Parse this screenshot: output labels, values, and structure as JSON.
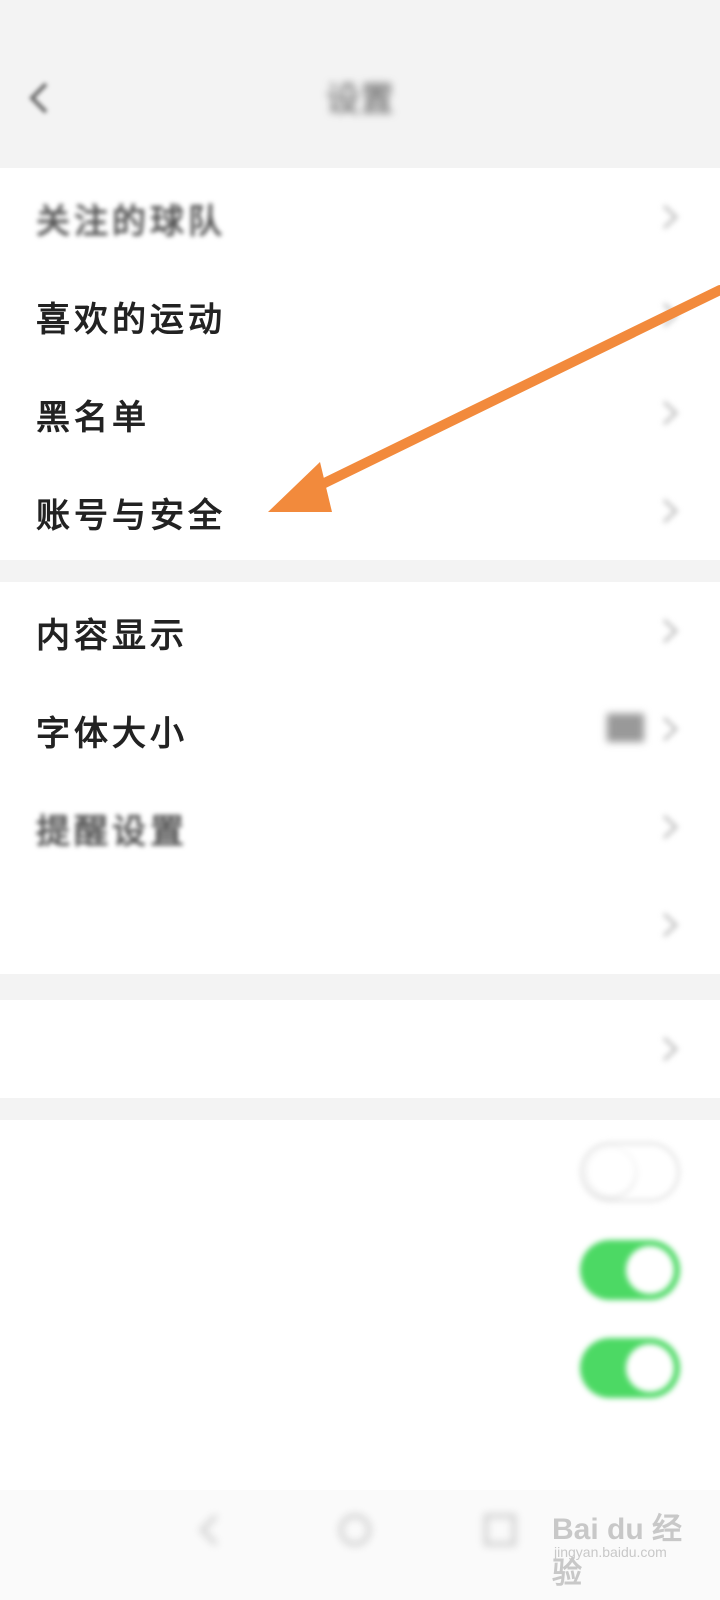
{
  "status_bar": {
    "left_text": "",
    "right_text": ""
  },
  "header": {
    "title": "设置"
  },
  "groups": [
    {
      "rows": [
        {
          "label": "关注的球队"
        },
        {
          "label": "喜欢的运动"
        },
        {
          "label": "黑名单"
        },
        {
          "label": "账号与安全"
        }
      ]
    },
    {
      "rows": [
        {
          "label": "内容显示"
        },
        {
          "label": "字体大小"
        },
        {
          "label": "提醒设置"
        },
        {
          "label": ""
        }
      ]
    },
    {
      "rows": [
        {
          "label": ""
        }
      ]
    },
    {
      "rows": [
        {
          "label": ""
        },
        {
          "label": ""
        },
        {
          "label": "",
          "sublabel": ""
        }
      ]
    }
  ],
  "colors": {
    "annotation_arrow": "#f28a3c",
    "toggle_on": "#4cd964",
    "row_bg": "#ffffff",
    "page_bg": "#f3f3f3"
  },
  "watermark": {
    "brand": "Bai du 经验",
    "url": "jingyan.baidu.com"
  }
}
